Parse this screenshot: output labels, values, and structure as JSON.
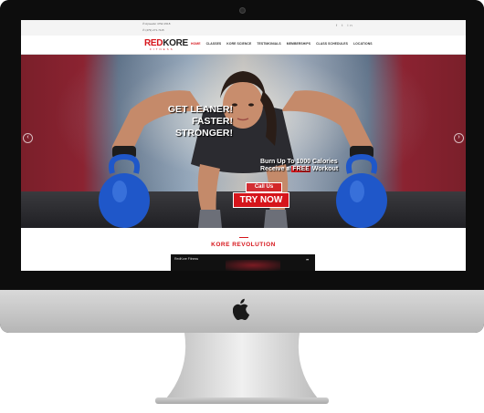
{
  "topbar": {
    "contact_1": "✆ Ajmeefer 4792-1518",
    "contact_2": "✆ (479) 271-7115",
    "social": "f  t  in"
  },
  "header": {
    "logo_red": "RED",
    "logo_dark": "KORE",
    "logo_tag": "FITNESS",
    "nav": [
      "HOME",
      "CLASSES",
      "KORE SCIENCE",
      "TESTIMONIALS",
      "MEMBERSHIPS",
      "CLASS SCHEDULES",
      "LOCATIONS"
    ]
  },
  "hero": {
    "headline": [
      "GET LEANER!",
      "FASTER!",
      "STRONGER!"
    ],
    "promo_line1": "Burn Up To 1000 Calories",
    "promo_line2_a": "Receive a",
    "promo_free": "FREE",
    "promo_line2_b": "Workout",
    "call_us": "Call Us",
    "try_now": "TRY NOW"
  },
  "section": {
    "title": "KORE REVOLUTION",
    "video_title": "RedKore Fitness"
  },
  "colors": {
    "accent": "#d6151b",
    "hero_side": "#8b2331",
    "kettlebell": "#1f57c9"
  },
  "icons": [
    "camera-icon",
    "apple-logo-icon",
    "prev-arrow-icon",
    "next-arrow-icon",
    "share-icon"
  ]
}
